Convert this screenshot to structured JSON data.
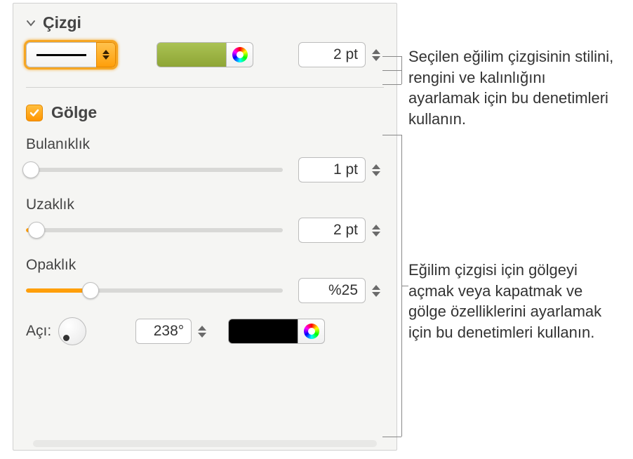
{
  "line": {
    "title": "Çizgi",
    "thickness": "2 pt"
  },
  "shadow": {
    "title": "Gölge",
    "checked": true,
    "blur": {
      "label": "Bulanıklık",
      "value": "1 pt",
      "pct": 2
    },
    "distance": {
      "label": "Uzaklık",
      "value": "2 pt",
      "pct": 4
    },
    "opacity": {
      "label": "Opaklık",
      "value": "%25",
      "pct": 25
    },
    "angle": {
      "label": "Açı:",
      "value": "238°"
    }
  },
  "colors": {
    "line": "#98b13c",
    "shadow": "#000000",
    "accent": "#ff9f0a"
  },
  "annot": {
    "top": "Seçilen eğilim çizgisinin stilini, rengini ve kalınlığını ayarlamak için bu denetimleri kullanın.",
    "bottom": "Eğilim çizgisi için gölgeyi açmak veya kapatmak ve gölge özelliklerini ayarlamak için bu denetimleri kullanın."
  }
}
